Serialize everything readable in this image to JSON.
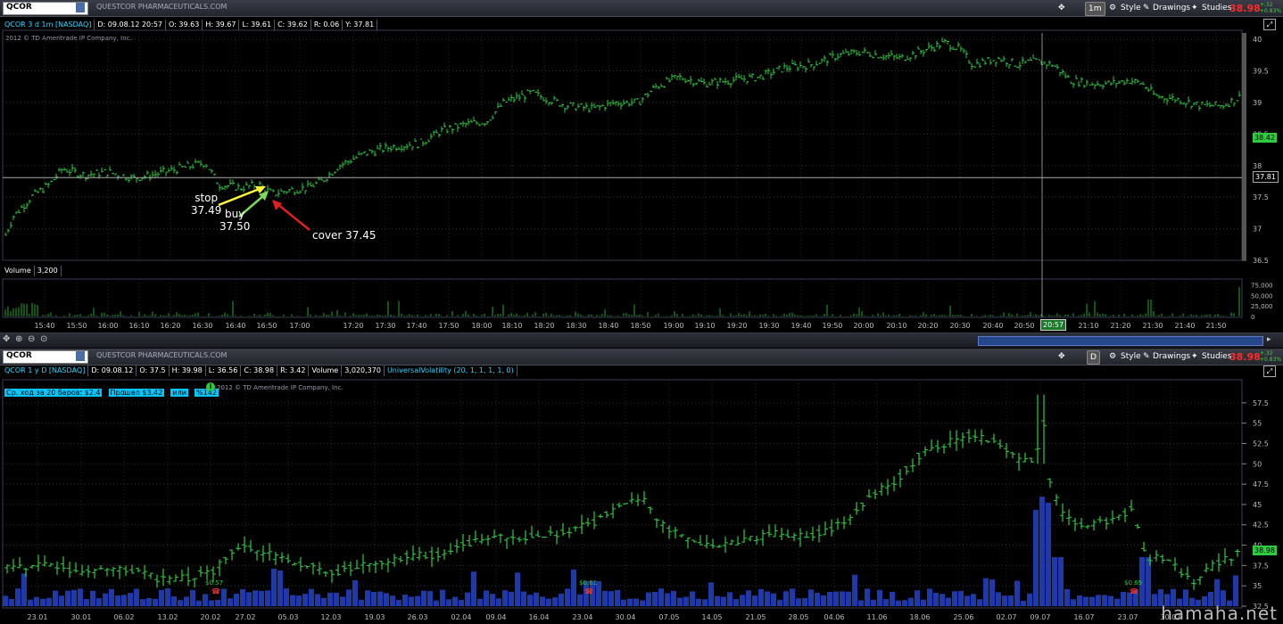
{
  "top": {
    "symbol": "QCOR",
    "company": "QUESTCOR PHARMACEUTICALS.COM",
    "timeframe_btn": "1m",
    "style_label": "Style",
    "drawings_label": "Drawings",
    "studies_label": "Studies",
    "last_price": "38.98",
    "change": "+.32",
    "change_pct": "+0.83%",
    "info": [
      "QCOR 3 d 1m [NASDAQ]",
      "D: 09.08.12 20:57",
      "O: 39.63",
      "H: 39.67",
      "L: 39.61",
      "C: 39.62",
      "R: 0.06",
      "Y: 37.81"
    ],
    "copyright": "2012 © TD Ameritrade IP Company, Inc.",
    "price_tags": {
      "tag1": "38.42",
      "tag2": "37.81"
    },
    "volume_label": "Volume",
    "volume_value": "3,200",
    "crosshair_time": "20:57",
    "annotations": {
      "stop": "stop",
      "stop_price": "37.49",
      "buy": "buy",
      "buy_price": "37.50",
      "cover": "cover 37.45"
    }
  },
  "bottom": {
    "symbol": "QCOR",
    "company": "QUESTCOR PHARMACEUTICALS.COM",
    "timeframe_btn": "D",
    "style_label": "Style",
    "drawings_label": "Drawings",
    "studies_label": "Studies",
    "last_price": "38.98",
    "change": "+.32",
    "change_pct": "+0.83%",
    "info": [
      "QCOR 1 y D [NASDAQ]",
      "D: 09.08.12",
      "O: 37.5",
      "H: 39.98",
      "L: 36.56",
      "C: 38.98",
      "R: 3.42",
      "Volume",
      "3,020,370",
      "UniversalVolatility (20, 1, 1, 1, 1, 0)"
    ],
    "stats": [
      "Ср. ход за 20 баров: $2.4",
      "Прошел $3.42",
      "или",
      "%142"
    ],
    "copyright": "2012 © TD Ameritrade IP Company, Inc.",
    "price_tag": "38.98",
    "dividends": [
      "$0.57",
      "$0.61",
      "$0.69"
    ]
  },
  "watermark": "hamaha.net",
  "colors": {
    "bar": "#2ecc40",
    "volume_intraday": "#1faa2a",
    "volume_daily": "#1e3aa8",
    "accent": "#2ad4ff",
    "last_price": "#ff2a2a"
  },
  "chart_data": [
    {
      "type": "bar",
      "title": "QCOR 3 d 1m [NASDAQ]",
      "ylim": [
        36.5,
        40.1
      ],
      "y_ticks": [
        36.5,
        37,
        37.5,
        38,
        38.5,
        39,
        39.5,
        40
      ],
      "x_ticks": [
        "15:40",
        "15:50",
        "16:00",
        "16:10",
        "16:20",
        "16:30",
        "16:40",
        "16:50",
        "17:00",
        "17:20",
        "17:30",
        "17:40",
        "17:50",
        "18:00",
        "18:10",
        "18:20",
        "18:30",
        "18:40",
        "18:50",
        "19:00",
        "19:10",
        "19:20",
        "19:30",
        "19:40",
        "19:50",
        "20:00",
        "20:10",
        "20:20",
        "20:30",
        "20:40",
        "20:50",
        "21:10",
        "21:20",
        "21:30",
        "21:40",
        "21:50"
      ],
      "price_path": [
        [
          0,
          36.7
        ],
        [
          15,
          37.2
        ],
        [
          35,
          37.5
        ],
        [
          55,
          37.7
        ],
        [
          70,
          37.95
        ],
        [
          95,
          37.85
        ],
        [
          120,
          37.9
        ],
        [
          150,
          37.8
        ],
        [
          170,
          37.85
        ],
        [
          200,
          37.95
        ],
        [
          230,
          38.05
        ],
        [
          245,
          37.7
        ],
        [
          270,
          37.65
        ],
        [
          290,
          37.7
        ],
        [
          305,
          37.55
        ],
        [
          320,
          37.6
        ],
        [
          345,
          37.65
        ],
        [
          360,
          37.75
        ],
        [
          380,
          38.0
        ],
        [
          410,
          38.2
        ],
        [
          440,
          38.3
        ],
        [
          470,
          38.35
        ],
        [
          495,
          38.55
        ],
        [
          520,
          38.65
        ],
        [
          545,
          38.7
        ],
        [
          565,
          39.0
        ],
        [
          595,
          39.15
        ],
        [
          615,
          39.05
        ],
        [
          635,
          38.95
        ],
        [
          665,
          38.9
        ],
        [
          690,
          39.0
        ],
        [
          715,
          39.0
        ],
        [
          735,
          39.25
        ],
        [
          760,
          39.4
        ],
        [
          790,
          39.3
        ],
        [
          820,
          39.35
        ],
        [
          850,
          39.4
        ],
        [
          880,
          39.55
        ],
        [
          910,
          39.6
        ],
        [
          940,
          39.75
        ],
        [
          965,
          39.8
        ],
        [
          985,
          39.75
        ],
        [
          1010,
          39.7
        ],
        [
          1040,
          39.85
        ],
        [
          1060,
          39.95
        ],
        [
          1075,
          39.85
        ],
        [
          1090,
          39.6
        ],
        [
          1105,
          39.65
        ],
        [
          1120,
          39.7
        ],
        [
          1140,
          39.6
        ],
        [
          1160,
          39.65
        ],
        [
          1180,
          39.6
        ],
        [
          1200,
          39.35
        ],
        [
          1220,
          39.3
        ],
        [
          1245,
          39.3
        ],
        [
          1265,
          39.35
        ],
        [
          1280,
          39.3
        ],
        [
          1295,
          39.1
        ],
        [
          1320,
          39.05
        ],
        [
          1345,
          38.95
        ],
        [
          1370,
          38.95
        ],
        [
          1392,
          39.1
        ]
      ],
      "volume": {
        "label": "Volume",
        "value": 3200,
        "y_ticks": [
          0,
          25000,
          50000,
          75000
        ]
      },
      "annotations": [
        "stop 37.49",
        "buy 37.50",
        "cover 37.45"
      ]
    },
    {
      "type": "bar",
      "title": "QCOR 1 y D [NASDAQ]",
      "ylim": [
        32.5,
        58.8
      ],
      "y_ticks": [
        32.5,
        35,
        37.5,
        40,
        42.5,
        45,
        47.5,
        50,
        52.5,
        55,
        57.5
      ],
      "x_ticks": [
        "23.01",
        "30.01",
        "06.02",
        "13.02",
        "20.02",
        "27.02",
        "05.03",
        "12.03",
        "19.03",
        "26.03",
        "02.04",
        "09.04",
        "16.04",
        "23.04",
        "30.04",
        "07.05",
        "14.05",
        "21.05",
        "28.05",
        "04.06",
        "11.06",
        "18.06",
        "25.06",
        "02.07",
        "09.07",
        "16.07",
        "23.07",
        "30.07"
      ],
      "price_path": [
        [
          0,
          37.5
        ],
        [
          30,
          37.0
        ],
        [
          60,
          37.8
        ],
        [
          90,
          36.5
        ],
        [
          120,
          37.2
        ],
        [
          150,
          37.0
        ],
        [
          180,
          35.8
        ],
        [
          210,
          36.0
        ],
        [
          240,
          36.8
        ],
        [
          265,
          39.8
        ],
        [
          290,
          39.4
        ],
        [
          320,
          38.0
        ],
        [
          345,
          37.6
        ],
        [
          370,
          36.5
        ],
        [
          400,
          37.5
        ],
        [
          430,
          37.8
        ],
        [
          460,
          38.6
        ],
        [
          490,
          38.8
        ],
        [
          520,
          40.0
        ],
        [
          550,
          41.0
        ],
        [
          580,
          40.8
        ],
        [
          610,
          41.2
        ],
        [
          640,
          41.8
        ],
        [
          670,
          43.0
        ],
        [
          700,
          45.0
        ],
        [
          720,
          46.0
        ],
        [
          745,
          42.0
        ],
        [
          780,
          40.5
        ],
        [
          810,
          40.2
        ],
        [
          840,
          40.6
        ],
        [
          870,
          41.5
        ],
        [
          900,
          41.0
        ],
        [
          930,
          41.8
        ],
        [
          955,
          43.5
        ],
        [
          980,
          46.5
        ],
        [
          1005,
          48.0
        ],
        [
          1030,
          51.0
        ],
        [
          1060,
          52.5
        ],
        [
          1085,
          53.5
        ],
        [
          1110,
          53.0
        ],
        [
          1135,
          51.0
        ],
        [
          1155,
          50.0
        ],
        [
          1163,
          52.0
        ],
        [
          1168,
          57.5
        ],
        [
          1176,
          48.0
        ],
        [
          1190,
          44.0
        ],
        [
          1210,
          42.5
        ],
        [
          1240,
          43.0
        ],
        [
          1270,
          44.5
        ],
        [
          1285,
          38.0
        ],
        [
          1300,
          38.5
        ],
        [
          1320,
          37.0
        ],
        [
          1340,
          35.5
        ],
        [
          1360,
          37.5
        ],
        [
          1390,
          38.98
        ]
      ],
      "dividends": [
        "$0.57",
        "$0.61",
        "$0.69"
      ]
    }
  ]
}
